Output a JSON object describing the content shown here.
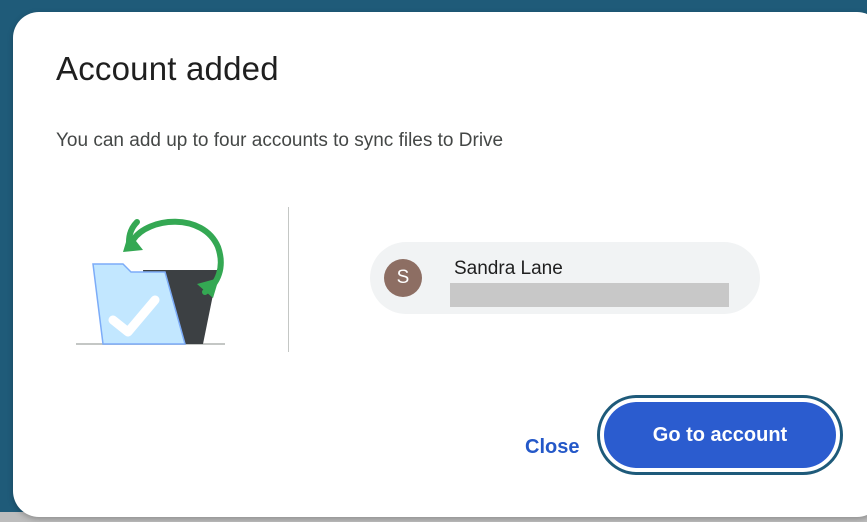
{
  "dialog": {
    "title": "Account added",
    "subtitle": "You can add up to four accounts to sync files to Drive"
  },
  "account": {
    "avatar_initial": "S",
    "name": "Sandra Lane"
  },
  "actions": {
    "close_label": "Close",
    "go_label": "Go to account"
  },
  "colors": {
    "accent": "#2b5ccf",
    "link": "#2458c8",
    "avatar": "#8d6e63",
    "sync_arrow": "#34a853",
    "folder": "#c2e7ff"
  },
  "icons": {
    "illustration": "folder-sync-check-icon"
  }
}
